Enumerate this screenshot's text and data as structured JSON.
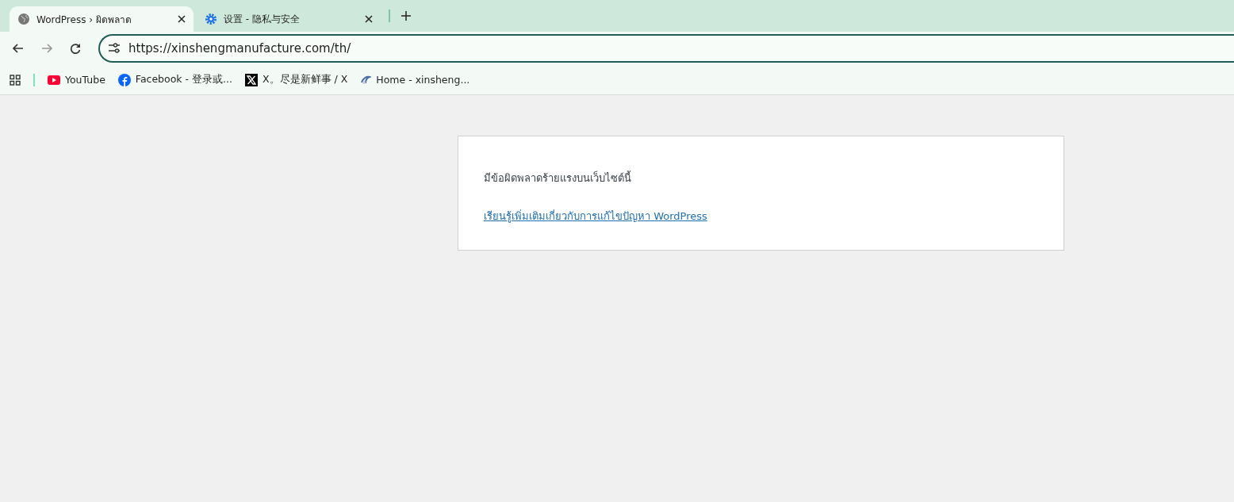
{
  "tabs": [
    {
      "kind": "globe",
      "title": "WordPress › ผิดพลาด",
      "selected": true
    },
    {
      "kind": "gear",
      "title": "设置 - 隐私与安全",
      "selected": false
    }
  ],
  "address_bar": {
    "url": "https://xinshengmanufacture.com/th/"
  },
  "bookmarks": [
    {
      "kind": "youtube",
      "label": "YouTube"
    },
    {
      "kind": "facebook",
      "label": "Facebook - 登录或..."
    },
    {
      "kind": "x",
      "label": "X。尽是新鲜事 / X"
    },
    {
      "kind": "site",
      "label": "Home - xinsheng..."
    }
  ],
  "page": {
    "message": "มีข้อผิดพลาดร้ายแรงบนเว็บไซต์นี้",
    "link": "เรียนรู้เพิ่มเติมเกี่ยวกับการแก้ไขปัญหา WordPress"
  }
}
